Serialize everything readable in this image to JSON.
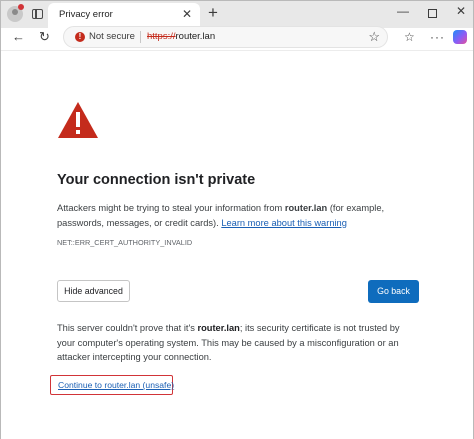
{
  "tab": {
    "title": "Privacy error",
    "close": "✕"
  },
  "new_tab": "+",
  "window_controls": {
    "minimize": "—",
    "close": "✕"
  },
  "toolbar": {
    "back": "←",
    "reload": "↻",
    "favorites": "☆",
    "more": "···"
  },
  "address_bar": {
    "security_label": "Not secure",
    "url_scheme": "https://",
    "url_host": "router.lan",
    "star": "☆"
  },
  "page": {
    "heading": "Your connection isn't private",
    "description": "Attackers might be trying to steal your information from ",
    "host_bold": "router.lan",
    "description_tail": " (for example, passwords, messages, or credit cards). ",
    "learn_more_link": "Learn more about this warning",
    "error_code": "NET::ERR_CERT_AUTHORITY_INVALID",
    "hide_advanced_button": "Hide advanced",
    "go_back_button": "Go back",
    "details_prefix": "This server couldn't prove that it's ",
    "details_host": "router.lan",
    "details_suffix": "; its security certificate is not trusted by your computer's operating system. This may be caused by a misconfiguration or an attacker intercepting your connection.",
    "proceed_link": "Continue to router.lan (unsafe)"
  },
  "colors": {
    "warning_red": "#c42b1c",
    "primary_button": "#0f6cbd",
    "link": "#1a5fb4",
    "highlight_box": "#d13438"
  },
  "icons": {
    "profile": "profile-avatar-icon",
    "tabs": "tab-actions-icon",
    "warning": "warning-triangle-icon",
    "security": "not-secure-icon",
    "copilot": "copilot-icon"
  }
}
